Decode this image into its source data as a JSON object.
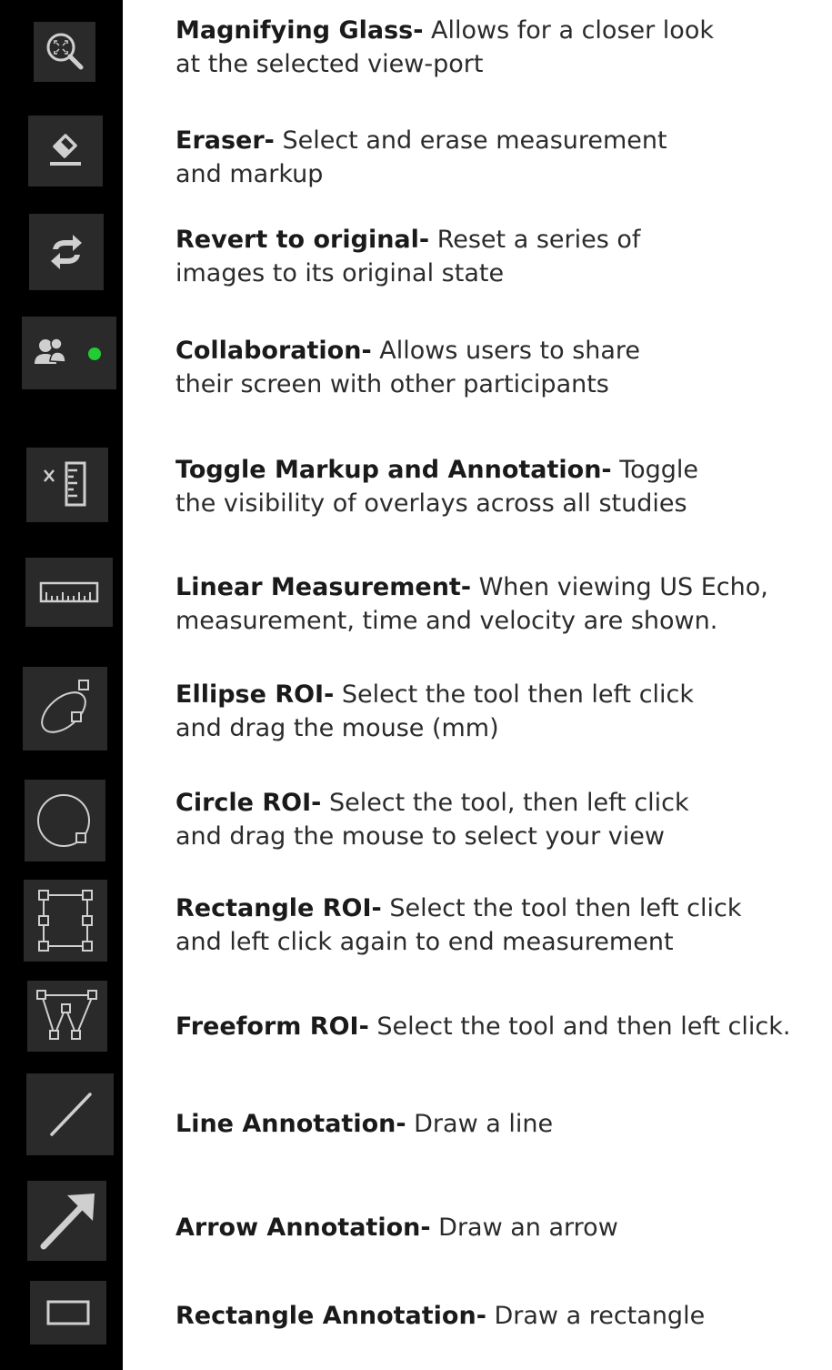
{
  "colors": {
    "strip": "#000000",
    "button": "#2a2a2a",
    "icon": "#cfcfcf",
    "status": "#22cc33"
  },
  "tools": [
    {
      "icon": "magnifying-glass-icon",
      "name": "Magnifying Glass-",
      "desc1": " Allows for a closer look",
      "desc2": "at the selected view-port"
    },
    {
      "icon": "eraser-icon",
      "name": "Eraser-",
      "desc1": " Select and erase  measurement",
      "desc2": "and markup"
    },
    {
      "icon": "revert-icon",
      "name": "Revert to original-",
      "desc1": " Reset a series of",
      "desc2": "images to its original state"
    },
    {
      "icon": "collaboration-icon",
      "name": "Collaboration-",
      "desc1": " Allows users to share",
      "desc2": "their screen with other participants"
    },
    {
      "icon": "toggle-markup-icon",
      "name": "Toggle Markup and Annotation-",
      "desc1": " Toggle",
      "desc2": "the visibility of overlays across all studies"
    },
    {
      "icon": "ruler-icon",
      "name": "Linear Measurement-",
      "desc1": " When viewing US Echo,",
      "desc2": "measurement, time and velocity are shown."
    },
    {
      "icon": "ellipse-roi-icon",
      "name": "Ellipse ROI-",
      "desc1": " Select the tool then left click",
      "desc2": "and drag the mouse (mm)"
    },
    {
      "icon": "circle-roi-icon",
      "name": "Circle ROI-",
      "desc1": " Select the tool, then left click",
      "desc2": "and drag the mouse to select your view"
    },
    {
      "icon": "rectangle-roi-icon",
      "name": "Rectangle ROI-",
      "desc1": "  Select the tool then left click",
      "desc2": "and left click again to end measurement"
    },
    {
      "icon": "freeform-roi-icon",
      "name": "Freeform ROI-",
      "desc1": "  Select the tool and then left click.",
      "desc2": ""
    },
    {
      "icon": "line-icon",
      "name": "Line Annotation-",
      "desc1": " Draw a line",
      "desc2": ""
    },
    {
      "icon": "arrow-icon",
      "name": "Arrow Annotation-",
      "desc1": " Draw an arrow",
      "desc2": ""
    },
    {
      "icon": "rectangle-icon",
      "name": "Rectangle Annotation-",
      "desc1": " Draw a rectangle",
      "desc2": ""
    }
  ]
}
